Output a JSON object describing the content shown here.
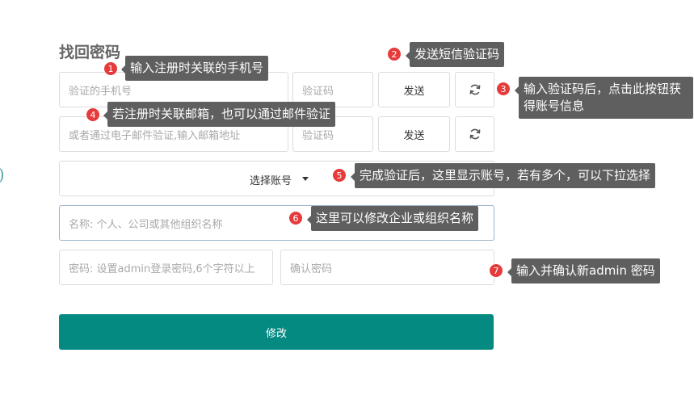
{
  "page": {
    "title": "找回密码"
  },
  "form": {
    "phone_placeholder": "验证的手机号",
    "code_placeholder": "验证码",
    "send_label": "发送",
    "email_placeholder": "或者通过电子邮件验证,输入邮箱地址",
    "email_code_placeholder": "验证码",
    "email_send_label": "发送",
    "account_select_label": "选择账号",
    "name_placeholder": "名称: 个人、公司或其他组织名称",
    "password_placeholder": "密码: 设置admin登录密码,6个字符以上",
    "confirm_placeholder": "确认密码",
    "submit_label": "修改"
  },
  "annotations": [
    {
      "number": "1",
      "text": "输入注册时关联的手机号"
    },
    {
      "number": "2",
      "text": "发送短信验证码"
    },
    {
      "number": "3",
      "text": "输入验证码后，点击此按钮获得账号信息"
    },
    {
      "number": "4",
      "text": "若注册时关联邮箱，也可以通过邮件验证"
    },
    {
      "number": "5",
      "text": "完成验证后，这里显示账号，若有多个，可以下拉选择"
    },
    {
      "number": "6",
      "text": "这里可以修改企业或组织名称"
    },
    {
      "number": "7",
      "text": "输入并确认新admin 密码"
    }
  ],
  "colors": {
    "accent": "#058a82",
    "badge": "#e63b3b",
    "tooltip": "#5f5f5f"
  }
}
